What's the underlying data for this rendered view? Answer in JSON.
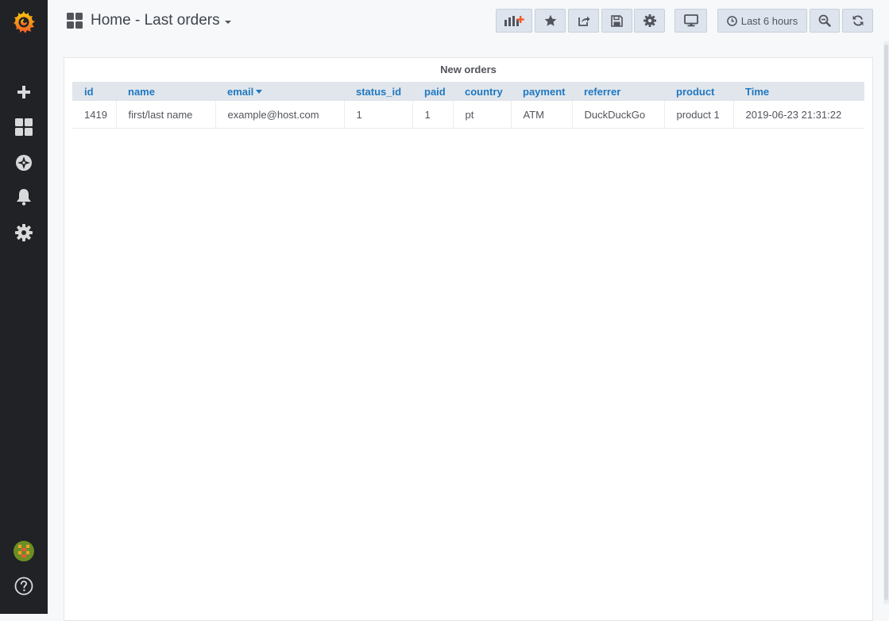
{
  "dashboard": {
    "title": "Home - Last orders"
  },
  "toolbar": {
    "time_range_label": "Last 6 hours"
  },
  "panel": {
    "title": "New orders",
    "columns": [
      "id",
      "name",
      "email",
      "status_id",
      "paid",
      "country",
      "payment",
      "referrer",
      "product",
      "Time"
    ],
    "sort_column": "email",
    "rows": [
      [
        "1419",
        "first/last name",
        "example@host.com",
        "1",
        "1",
        "pt",
        "ATM",
        "DuckDuckGo",
        "product 1",
        "2019-06-23 21:31:22"
      ]
    ]
  },
  "colors": {
    "sidebar_bg": "#202226",
    "header_text": "#1f78c1",
    "logo_orange": "#f05a28"
  },
  "icons": {
    "logo": "grafana-logo-icon",
    "create": "plus-icon",
    "dashboards": "apps-grid-icon",
    "explore": "compass-icon",
    "alerting": "bell-icon",
    "configuration": "gear-icon",
    "profile": "avatar",
    "help": "question-circle-icon"
  }
}
